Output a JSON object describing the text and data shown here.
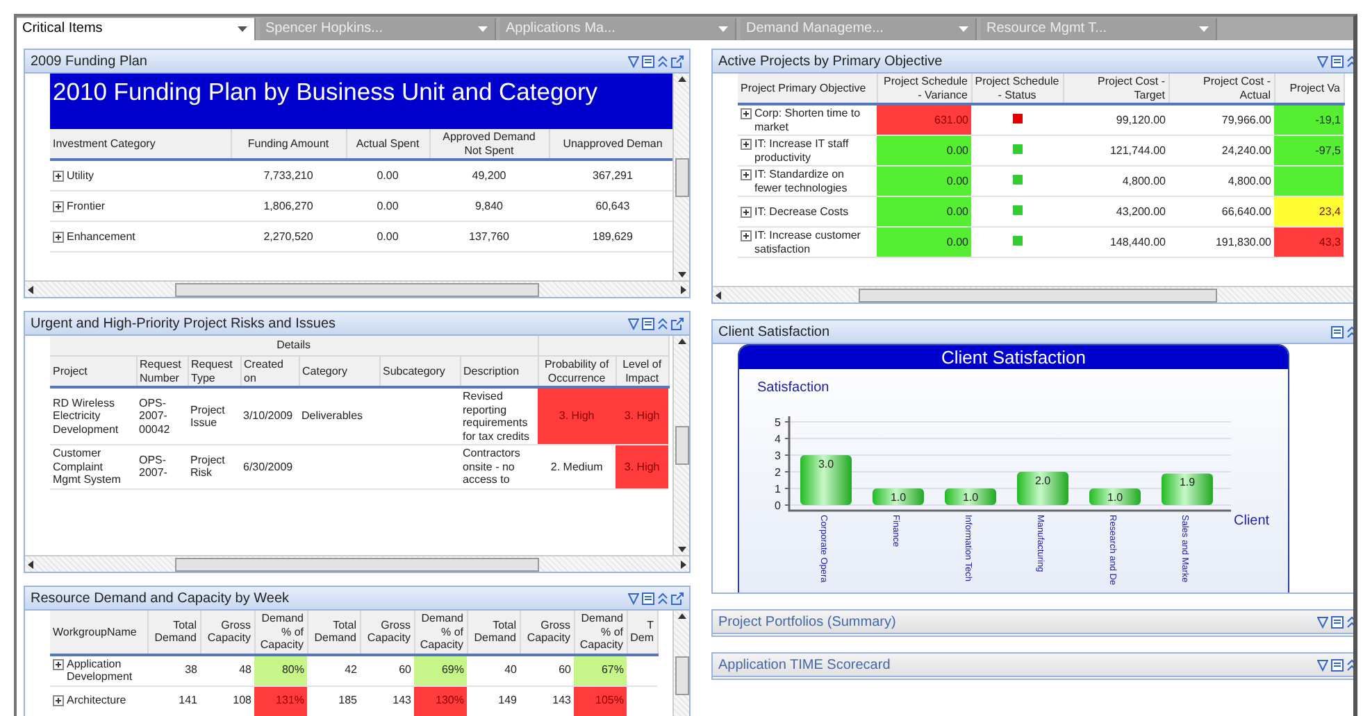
{
  "filter_bar": [
    {
      "kind": "combo",
      "label": "Critical Items"
    },
    {
      "kind": "dropdown",
      "label": "Spencer Hopkins..."
    },
    {
      "kind": "dropdown",
      "label": "Applications Ma..."
    },
    {
      "kind": "dropdown",
      "label": "Demand Manageme..."
    },
    {
      "kind": "dropdown",
      "label": "Resource Mgmt T..."
    }
  ],
  "funding": {
    "title": "2009 Funding Plan",
    "banner": "2010 Funding Plan by Business Unit and Category",
    "columns": [
      "Investment Category",
      "Funding Amount",
      "Actual Spent",
      "Approved Demand Not Spent",
      "Unapproved Deman"
    ],
    "rows": [
      {
        "expanded": false,
        "cells": [
          "Utility",
          "7,733,210",
          "0.00",
          "49,200",
          "367,291"
        ]
      },
      {
        "expanded": false,
        "cells": [
          "Frontier",
          "1,806,270",
          "0.00",
          "9,840",
          "60,643"
        ]
      },
      {
        "expanded": false,
        "cells": [
          "Enhancement",
          "2,270,520",
          "0.00",
          "137,760",
          "189,629"
        ]
      }
    ]
  },
  "risks": {
    "title": "Urgent and High-Priority Project Risks and Issues",
    "group_header": "Details",
    "columns": [
      "Project",
      "Request Number",
      "Request Type",
      "Created on",
      "Category",
      "Subcategory",
      "Description",
      "Probability of Occurrence",
      "Level of Impact"
    ],
    "rows": [
      {
        "cells": [
          "RD Wireless Electricity Development",
          "OPS-2007-00042",
          "Project Issue",
          "3/10/2009",
          "Deliverables",
          null,
          "Revised reporting requirements for tax credits",
          {
            "text": "3. High",
            "color": "#ff3b3b"
          },
          {
            "text": "3. High",
            "color": "#ff3b3b"
          }
        ]
      },
      {
        "cells": [
          "Customer Complaint Mgmt System",
          "OPS-2007-",
          "Project Risk",
          "6/30/2009",
          null,
          null,
          "Contractors onsite - no access to",
          "2. Medium",
          {
            "text": "3. High",
            "color": "#ff3b3b"
          }
        ]
      }
    ]
  },
  "resource": {
    "title": "Resource Demand and Capacity by Week",
    "columns": [
      "WorkgroupName",
      "Total Demand",
      "Gross Capacity",
      "Demand % of Capacity",
      "Total Demand",
      "Gross Capacity",
      "Demand % of Capacity",
      "Total Demand",
      "Gross Capacity",
      "Demand % of Capacity",
      "T Dem"
    ],
    "rows": [
      {
        "expanded": false,
        "cells": [
          "Application Development",
          "38",
          "48",
          {
            "text": "80%",
            "color": "#c8f58a"
          },
          "42",
          "60",
          {
            "text": "69%",
            "color": "#c8f58a"
          },
          "40",
          "60",
          {
            "text": "67%",
            "color": "#c8f58a"
          },
          null
        ]
      },
      {
        "expanded": false,
        "cells": [
          "Architecture",
          "141",
          "108",
          {
            "text": "131%",
            "color": "#ff3b3b"
          },
          "185",
          "143",
          {
            "text": "130%",
            "color": "#ff3b3b"
          },
          "149",
          "143",
          {
            "text": "105%",
            "color": "#ff3b3b"
          },
          null
        ]
      }
    ]
  },
  "projects": {
    "title": "Active Projects by Primary Objective",
    "columns": [
      "Project Primary Objective",
      "Project Schedule - Variance",
      "Project Schedule - Status",
      "Project Cost - Target",
      "Project Cost - Actual",
      "Project Va"
    ],
    "rows": [
      {
        "expanded": false,
        "cells": [
          "Corp: Shorten time to market",
          {
            "text": "631.00",
            "color": "#ff3b3b"
          },
          {
            "kind": "dot",
            "color": "#e00000"
          },
          "99,120.00",
          "79,966.00",
          {
            "text": "-19,1",
            "color": "#55ee33"
          }
        ]
      },
      {
        "expanded": false,
        "cells": [
          "IT: Increase IT staff productivity",
          {
            "text": "0.00",
            "color": "#55ee33"
          },
          {
            "kind": "dot",
            "color": "#33cc33"
          },
          "121,744.00",
          "24,240.00",
          {
            "text": "-97,5",
            "color": "#55ee33"
          }
        ]
      },
      {
        "expanded": false,
        "cells": [
          "IT: Standardize on fewer technologies",
          {
            "text": "0.00",
            "color": "#55ee33"
          },
          {
            "kind": "dot",
            "color": "#33cc33"
          },
          "4,800.00",
          "4,800.00",
          {
            "color": "#55ee33"
          }
        ]
      },
      {
        "expanded": false,
        "cells": [
          "IT: Decrease Costs",
          {
            "text": "0.00",
            "color": "#55ee33"
          },
          {
            "kind": "dot",
            "color": "#33cc33"
          },
          "43,200.00",
          "66,640.00",
          {
            "text": "23,4",
            "color": "#ffff33"
          }
        ]
      },
      {
        "expanded": false,
        "cells": [
          "IT: Increase customer satisfaction",
          {
            "text": "0.00",
            "color": "#55ee33"
          },
          {
            "kind": "dot",
            "color": "#33cc33"
          },
          "148,440.00",
          "191,830.00",
          {
            "text": "43,3",
            "color": "#ff3b3b"
          }
        ]
      }
    ]
  },
  "satisfaction": {
    "title": "Client Satisfaction",
    "chart_data": {
      "type": "bar",
      "title": "Client Satisfaction",
      "xlabel": "Client",
      "ylabel": "Satisfaction",
      "categories": [
        "Corporate Opera",
        "Finance",
        "Information Tech",
        "Manufacturing",
        "Research and De",
        "Sales and Marke"
      ],
      "values": [
        3.0,
        1.0,
        1.0,
        2.0,
        1.0,
        1.9
      ],
      "ylim": [
        0,
        5
      ],
      "yticks": [
        0,
        1,
        2,
        3,
        4,
        5
      ],
      "grid": true,
      "value_labels": [
        "3.0",
        "1.0",
        "1.0",
        "2.0",
        "1.0",
        "1.9"
      ]
    }
  },
  "collapsed_panels": [
    {
      "title": "Project Portfolios (Summary)"
    },
    {
      "title": "Application TIME Scorecard"
    }
  ]
}
